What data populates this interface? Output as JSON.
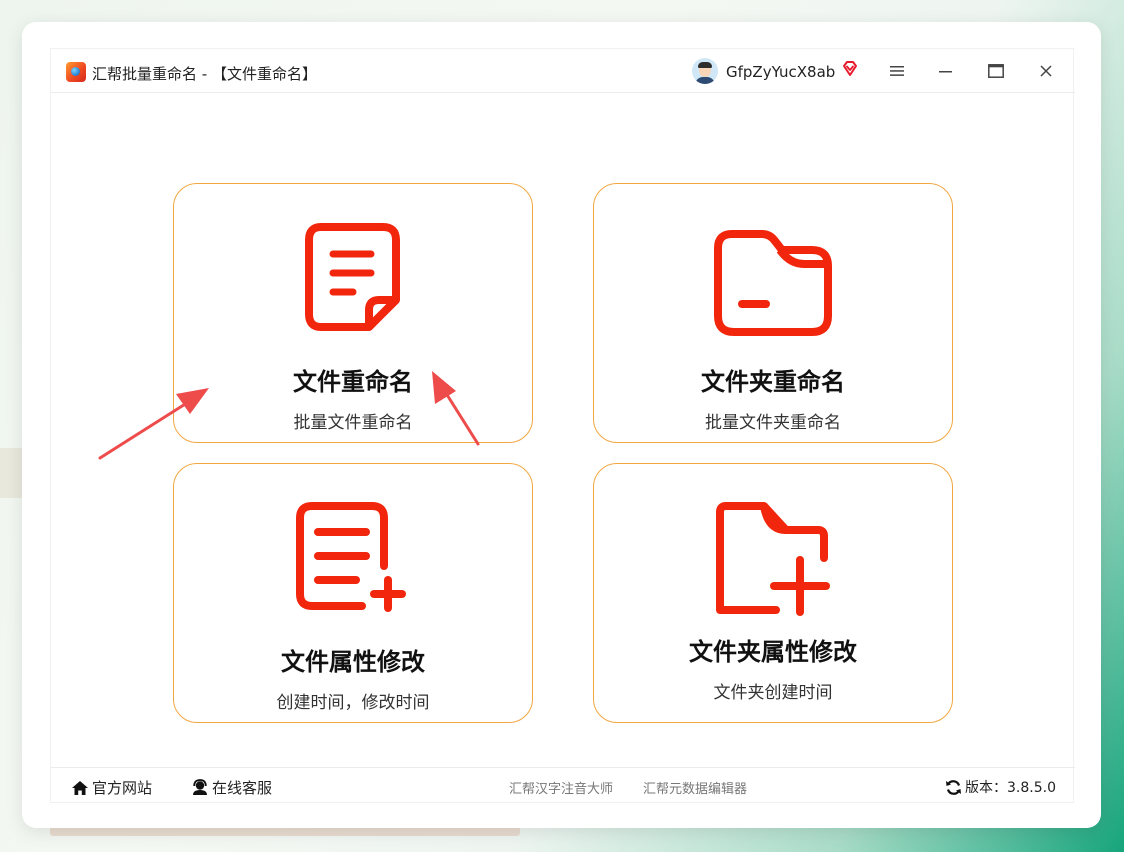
{
  "window": {
    "title": "汇帮批量重命名 - 【文件重命名】",
    "username": "GfpZyYucX8ab"
  },
  "cards": [
    {
      "title": "文件重命名",
      "subtitle": "批量文件重命名",
      "icon": "file-document-icon"
    },
    {
      "title": "文件夹重命名",
      "subtitle": "批量文件夹重命名",
      "icon": "folder-icon"
    },
    {
      "title": "文件属性修改",
      "subtitle": "创建时间，修改时间",
      "icon": "file-add-icon"
    },
    {
      "title": "文件夹属性修改",
      "subtitle": "文件夹创建时间",
      "icon": "folder-add-icon"
    }
  ],
  "footer": {
    "website": "官方网站",
    "service": "在线客服",
    "link1": "汇帮汉字注音大师",
    "link2": "汇帮元数据编辑器",
    "version": "版本：3.8.5.0"
  },
  "colors": {
    "accent": "#f2260c",
    "card_border": "#f2a742",
    "annotation_arrow": "#ee4b4b"
  }
}
